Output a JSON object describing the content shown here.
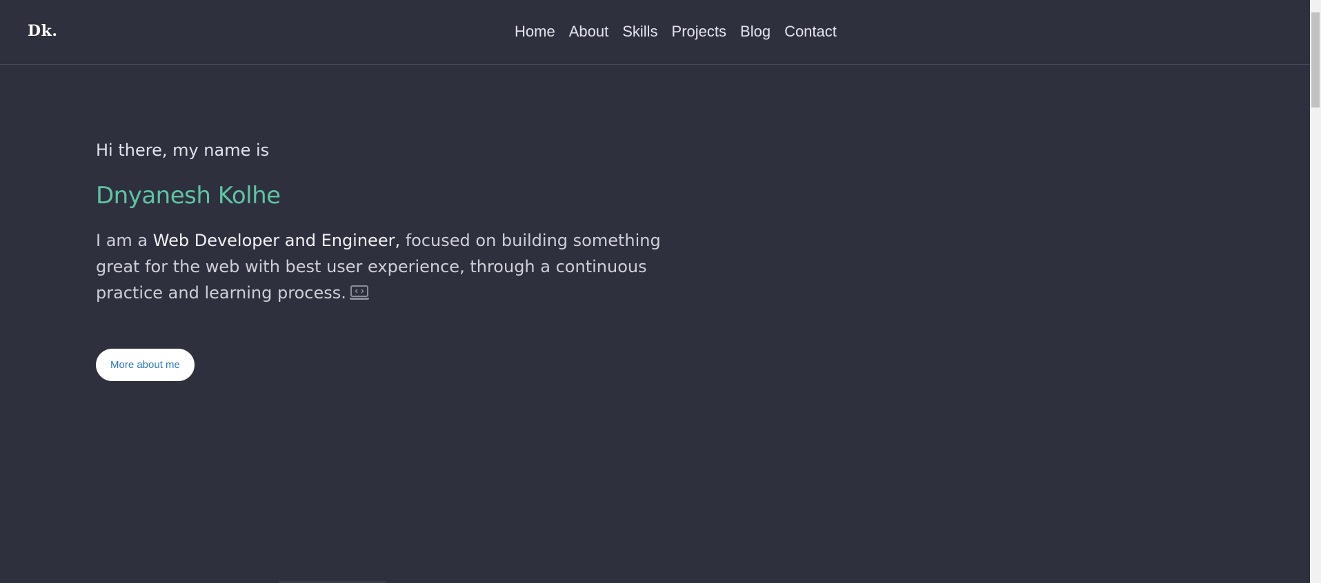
{
  "nav": {
    "logo": "Dk.",
    "links": [
      "Home",
      "About",
      "Skills",
      "Projects",
      "Blog",
      "Contact"
    ]
  },
  "hero": {
    "greeting": "Hi there, my name is",
    "name": "Dnyanesh Kolhe",
    "intro_prefix": "I am a ",
    "intro_highlight": "Web Developer and Engineer,",
    "intro_suffix": " focused on building something great for the web with best user experience, through a continuous practice and learning process.",
    "intro_icon": "laptop-code-icon",
    "cta_label": "More about me"
  },
  "colors": {
    "background": "#2e303d",
    "accent_name": "#5ec4a2",
    "button_text": "#2b79c2",
    "button_bg": "#ffffff"
  }
}
